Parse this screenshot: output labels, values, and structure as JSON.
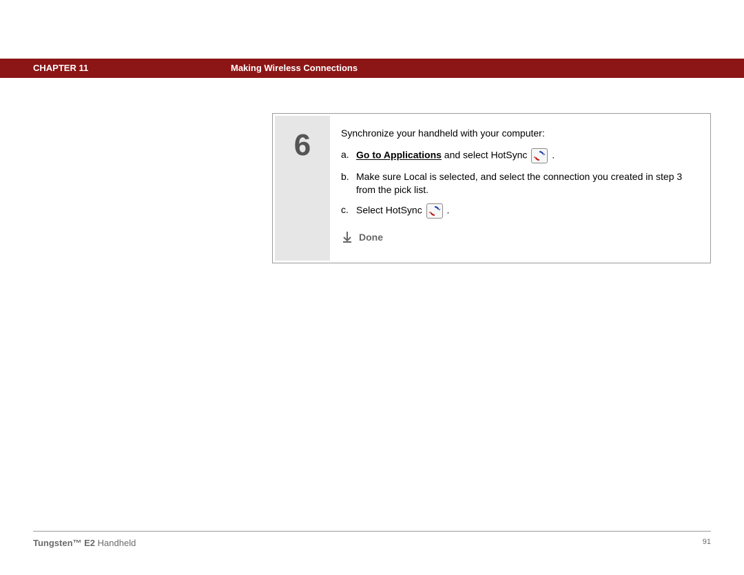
{
  "header": {
    "chapter_label": "CHAPTER",
    "chapter_num": "11",
    "title": "Making Wireless Connections"
  },
  "step": {
    "number": "6",
    "intro": "Synchronize your handheld with your computer:",
    "items": [
      {
        "marker": "a.",
        "link": "Go to Applications",
        "rest": " and select HotSync",
        "tail": " .",
        "icon": "hotsync-icon"
      },
      {
        "marker": "b.",
        "text": "Make sure Local is selected, and select the connection you created in step 3 from the pick list."
      },
      {
        "marker": "c.",
        "pre": "Select HotSync",
        "tail": " .",
        "icon": "hotsync-icon"
      }
    ],
    "done": "Done"
  },
  "footer": {
    "brand": "Tungsten™ E2",
    "product": " Handheld",
    "page": "91"
  }
}
